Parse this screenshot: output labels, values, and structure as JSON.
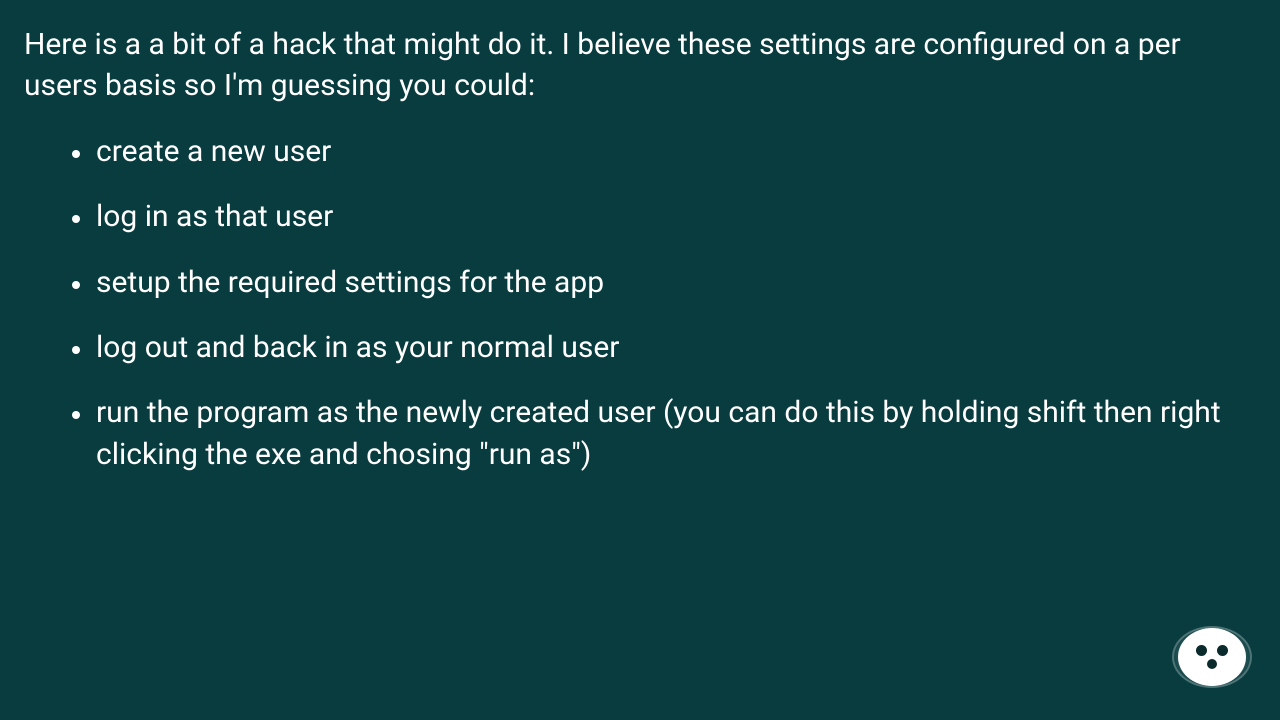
{
  "post": {
    "intro": "Here is a a bit of a hack that might do it. I believe these settings are configured on a per users basis so I'm guessing you could:",
    "steps": [
      "create a new user",
      "log in as that user",
      "setup the required settings for the app",
      "log out and back in as your normal user",
      "run the program as the newly created user (you can do this by holding shift then right clicking the exe and chosing \"run as\")"
    ]
  },
  "avatar": {
    "name": "author-avatar"
  }
}
